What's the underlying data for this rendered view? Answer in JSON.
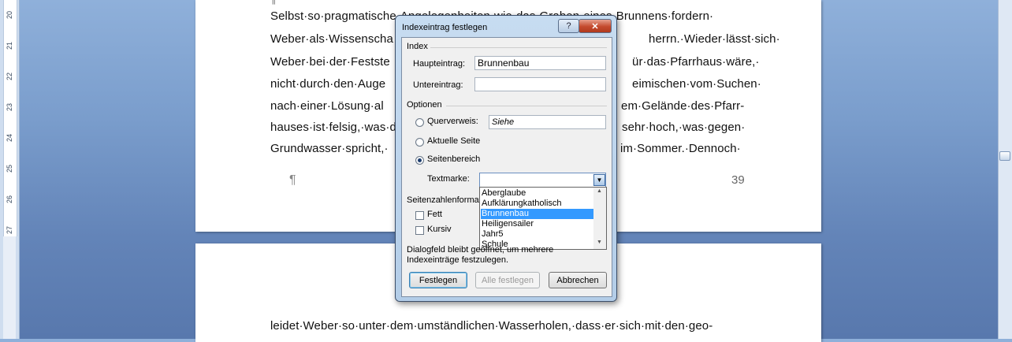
{
  "ruler": {
    "numbers": [
      "20",
      "21",
      "22",
      "23",
      "24",
      "25",
      "26",
      "27"
    ]
  },
  "document": {
    "page1_lines": [
      "Selbst·so·pragmatische·Angelegenheiten·wie·das·Graben·eines·Brunnens·fordern·",
      "Weber·als·Wissenscha",
      "herrn.·Wieder·lässt·sich·",
      "Weber·bei·der·Festste",
      "ür·das·Pfarrhaus·wäre,·",
      "nicht·durch·den·Auge",
      "eimischen·vom·Suchen·",
      "nach·einer·Lösung·al",
      "em·Gelände·des·Pfarr-",
      "hauses·ist·felsig,·was·d",
      "sehr·hoch,·was·gegen·",
      "Grundwasser·spricht,·",
      "im·Sommer.·Dennoch·"
    ],
    "top_mark": "¶",
    "pilcrow": "¶",
    "page_number": "39",
    "page2_line": "leidet·Weber·so·unter·dem·umständlichen·Wasserholen,·dass·er·sich·mit·den·geo-"
  },
  "dialog": {
    "title": "Indexeintrag festlegen",
    "help_symbol": "?",
    "close_symbol": "✕",
    "index_group": "Index",
    "haupteintrag_label": "Haupteintrag:",
    "haupteintrag_value": "Brunnenbau",
    "untereintrag_label": "Untereintrag:",
    "untereintrag_value": "",
    "optionen_group": "Optionen",
    "querverweis_label": "Querverweis:",
    "querverweis_value": "Siehe",
    "aktuelle_seite_label": "Aktuelle Seite",
    "seitenbereich_label": "Seitenbereich",
    "selected_option": "Seitenbereich",
    "textmarke_label": "Textmarke:",
    "textmarke_value": "",
    "textmarke_options": [
      "Aberglaube",
      "Aufklärungkatholisch",
      "Brunnenbau",
      "Heiligensailer",
      "Jahr5",
      "Schule"
    ],
    "textmarke_highlighted": "Brunnenbau",
    "seitenzahlenformat_group": "Seitenzahlenformat",
    "fett_label": "Fett",
    "kursiv_label": "Kursiv",
    "info_line1": "Dialogfeld bleibt geöffnet, um mehrere",
    "info_line2": "Indexeinträge festzulegen.",
    "btn_festlegen": "Festlegen",
    "btn_alle_festlegen": "Alle festlegen",
    "btn_abbrechen": "Abbrechen"
  }
}
